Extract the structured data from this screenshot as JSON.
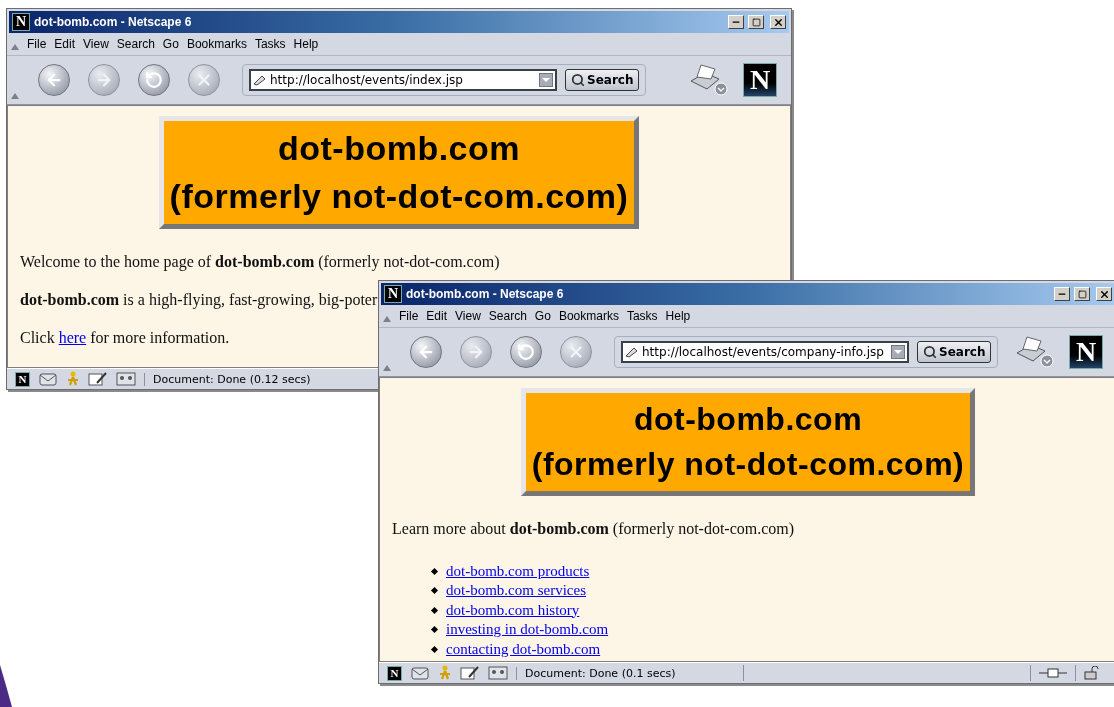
{
  "windows": [
    {
      "title": "dot-bomb.com - Netscape 6",
      "menu": [
        "File",
        "Edit",
        "View",
        "Search",
        "Go",
        "Bookmarks",
        "Tasks",
        "Help"
      ],
      "nav_buttons": [
        {
          "kind": "back",
          "disabled": false
        },
        {
          "kind": "forward",
          "disabled": true
        },
        {
          "kind": "reload",
          "disabled": false
        },
        {
          "kind": "stop",
          "disabled": true
        }
      ],
      "url": "http://localhost/events/index.jsp",
      "search_button": "Search",
      "banner": [
        "dot-bomb.com",
        "(formerly not-dot-com.com)"
      ],
      "content": [
        {
          "kind": "paragraph",
          "text": "Welcome to the home page of **dot-bomb.com** (formerly not-dot-com.com)"
        },
        {
          "kind": "paragraph",
          "text": "**dot-bomb.com** is a high-flying, fast-growing, big-poter"
        },
        {
          "kind": "link_paragraph",
          "before": "Click ",
          "link": "here",
          "after": " for more information."
        }
      ],
      "status": "Document: Done (0.12 secs)",
      "connection_icons": false,
      "title_logo": "N",
      "toolbar_logo": "N",
      "status_logo": "N"
    },
    {
      "title": "dot-bomb.com - Netscape 6",
      "menu": [
        "File",
        "Edit",
        "View",
        "Search",
        "Go",
        "Bookmarks",
        "Tasks",
        "Help"
      ],
      "nav_buttons": [
        {
          "kind": "back",
          "disabled": false
        },
        {
          "kind": "forward",
          "disabled": true
        },
        {
          "kind": "reload",
          "disabled": false
        },
        {
          "kind": "stop",
          "disabled": true
        }
      ],
      "url": "http://localhost/events/company-info.jsp",
      "search_button": "Search",
      "banner": [
        "dot-bomb.com",
        "(formerly not-dot-com.com)"
      ],
      "content": [
        {
          "kind": "paragraph",
          "text": "Learn more about **dot-bomb.com** (formerly not-dot-com.com)"
        },
        {
          "kind": "link_list",
          "items": [
            "dot-bomb.com products",
            "dot-bomb.com services",
            "dot-bomb.com history",
            "investing in dot-bomb.com",
            "contacting dot-bomb.com"
          ]
        }
      ],
      "status": "Document: Done (0.1 secs)",
      "connection_icons": true,
      "title_logo": "N",
      "toolbar_logo": "N",
      "status_logo": "N"
    }
  ]
}
